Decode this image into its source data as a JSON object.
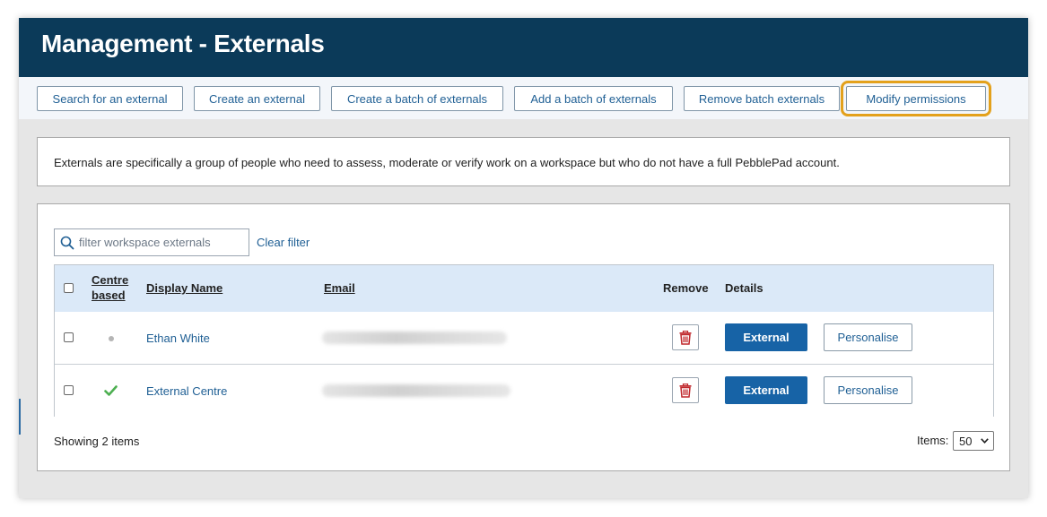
{
  "header": {
    "title": "Management - Externals"
  },
  "toolbar": {
    "buttons": [
      {
        "label": "Search for an external"
      },
      {
        "label": "Create an external"
      },
      {
        "label": "Create a batch of externals"
      },
      {
        "label": "Add a batch of externals"
      },
      {
        "label": "Remove batch externals"
      },
      {
        "label": "Modify permissions",
        "active": true
      }
    ]
  },
  "info": {
    "text": "Externals are specifically a group of people who need to assess, moderate or verify work on a workspace but who do not have a full PebblePad account."
  },
  "filter": {
    "placeholder": "filter workspace externals",
    "value": "",
    "clear_label": "Clear filter"
  },
  "table": {
    "columns": {
      "centre_based_1": "Centre",
      "centre_based_2": "based",
      "display_name": "Display Name",
      "email": "Email",
      "remove": "Remove",
      "details": "Details"
    },
    "rows": [
      {
        "display_name": "Ethan White",
        "centre_based": false,
        "email": "",
        "external_label": "External",
        "personalise_label": "Personalise",
        "remove_icon": "trash-icon"
      },
      {
        "display_name": "External Centre",
        "centre_based": true,
        "email": "",
        "external_label": "External",
        "personalise_label": "Personalise",
        "remove_icon": "trash-icon"
      }
    ]
  },
  "footer": {
    "showing": "Showing 2 items",
    "items_label": "Items:",
    "items_value": "50"
  },
  "colors": {
    "header_bg": "#0b3a59",
    "accent_blue": "#1763a6",
    "highlight_outline": "#e3a11c",
    "trash_red": "#c0282d",
    "tick_green": "#4caf50"
  }
}
